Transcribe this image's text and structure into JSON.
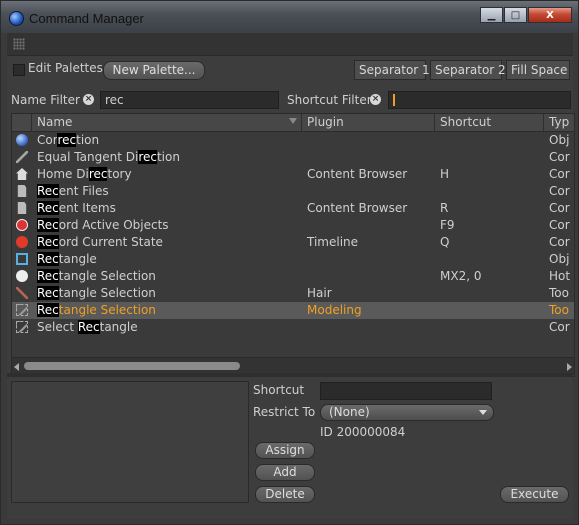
{
  "window": {
    "title": "Command Manager"
  },
  "window_buttons": {
    "minimize": "▁",
    "maximize": "□",
    "close": "X"
  },
  "toolbar": {
    "edit_palettes_label": "Edit Palettes",
    "new_palette_label": "New Palette...",
    "separator1_label": "Separator 1",
    "separator2_label": "Separator 2",
    "fill_space_label": "Fill Space"
  },
  "filters": {
    "name_filter_label": "Name Filter",
    "name_filter_value": "rec",
    "shortcut_filter_label": "Shortcut Filter",
    "shortcut_filter_value": ""
  },
  "table": {
    "columns": [
      "Name",
      "Plugin",
      "Shortcut",
      "Typ"
    ],
    "rows": [
      {
        "icon": "sphere-icon",
        "pre": "Cor",
        "match": "rec",
        "post": "tion",
        "plugin": "",
        "shortcut": "",
        "type": "Obj",
        "selected": false
      },
      {
        "icon": "tangent-icon",
        "pre": "Equal Tangent Di",
        "match": "rec",
        "post": "tion",
        "plugin": "",
        "shortcut": "",
        "type": "Cor",
        "selected": false
      },
      {
        "icon": "home-icon",
        "pre": "Home Di",
        "match": "rec",
        "post": "tory",
        "plugin": "Content Browser",
        "shortcut": "H",
        "type": "Cor",
        "selected": false
      },
      {
        "icon": "file-icon",
        "pre": "",
        "match": "Rec",
        "post": "ent Files",
        "plugin": "",
        "shortcut": "",
        "type": "Cor",
        "selected": false
      },
      {
        "icon": "file-icon",
        "pre": "",
        "match": "Rec",
        "post": "ent Items",
        "plugin": "Content Browser",
        "shortcut": "R",
        "type": "Cor",
        "selected": false
      },
      {
        "icon": "record-active-icon",
        "pre": "",
        "match": "Rec",
        "post": "ord Active Objects",
        "plugin": "",
        "shortcut": "F9",
        "type": "Cor",
        "selected": false
      },
      {
        "icon": "record-icon",
        "pre": "",
        "match": "Rec",
        "post": "ord Current State",
        "plugin": "Timeline",
        "shortcut": "Q",
        "type": "Cor",
        "selected": false
      },
      {
        "icon": "rectangle-icon",
        "pre": "",
        "match": "Rec",
        "post": "tangle",
        "plugin": "",
        "shortcut": "",
        "type": "Obj",
        "selected": false
      },
      {
        "icon": "circle-icon",
        "pre": "",
        "match": "Rec",
        "post": "tangle Selection",
        "plugin": "",
        "shortcut": "MX2, 0",
        "type": "Hot",
        "selected": false
      },
      {
        "icon": "hair-icon",
        "pre": "",
        "match": "Rec",
        "post": "tangle Selection",
        "plugin": "Hair",
        "shortcut": "",
        "type": "Too",
        "selected": false
      },
      {
        "icon": "select-rect-icon",
        "pre": "",
        "match": "Rec",
        "post": "tangle Selection",
        "plugin": "Modeling",
        "shortcut": "",
        "type": "Too",
        "selected": true
      },
      {
        "icon": "select-rect-icon",
        "pre": "Select ",
        "match": "Rec",
        "post": "tangle",
        "plugin": "",
        "shortcut": "",
        "type": "Cor",
        "selected": false
      }
    ]
  },
  "detail": {
    "shortcut_label": "Shortcut",
    "shortcut_value": "",
    "restrict_to_label": "Restrict To",
    "restrict_to_value": "(None)",
    "id_text": "ID 200000084",
    "assign_label": "Assign",
    "add_label": "Add",
    "delete_label": "Delete",
    "execute_label": "Execute"
  },
  "colors": {
    "highlight": "#f0a020",
    "background": "#3d3d3d"
  }
}
